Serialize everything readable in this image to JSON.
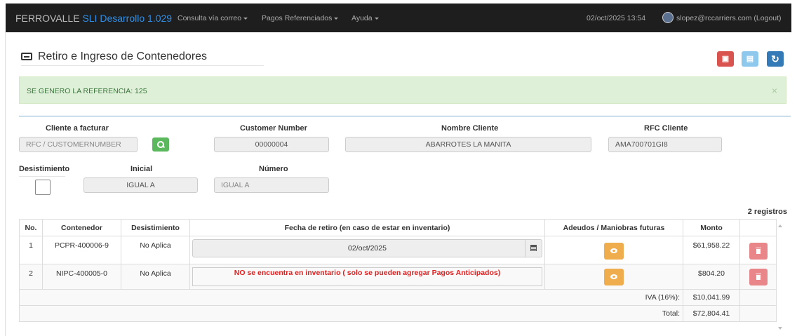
{
  "navbar": {
    "brand_prefix": "FERROVALLE",
    "brand_name": "SLI Desarrollo 1.029",
    "menu": [
      "Consulta vía correo",
      "Pagos Referenciados",
      "Ayuda"
    ],
    "datetime": "02/oct/2025 13:54",
    "user": "slopez@rccarriers.com (Logout)"
  },
  "header": {
    "title": "Retiro e Ingreso de Contenedores"
  },
  "alert": {
    "message": "SE GENERO LA REFERENCIA: 125",
    "close": "×"
  },
  "toolbar": {
    "refresh": "↻"
  },
  "form": {
    "cliente_label": "Cliente a facturar",
    "cliente_placeholder": "RFC / CUSTOMERNUMBER",
    "customer_number_label": "Customer Number",
    "customer_number_value": "00000004",
    "nombre_label": "Nombre Cliente",
    "nombre_value": "ABARROTES LA MANITA",
    "rfc_label": "RFC Cliente",
    "rfc_value": "AMA700701GI8",
    "desistimiento_label": "Desistimiento",
    "inicial_label": "Inicial",
    "inicial_value": "IGUAL A",
    "numero_label": "Número",
    "numero_value": "IGUAL A"
  },
  "table": {
    "count": "2 registros",
    "headers": [
      "No.",
      "Contenedor",
      "Desistimiento",
      "Fecha de retiro (en caso de estar en inventario)",
      "Adeudos / Maniobras futuras",
      "Monto",
      ""
    ],
    "rows": [
      {
        "no": "1",
        "contenedor": "PCPR-400006-9",
        "desistimiento": "No Aplica",
        "fecha": "02/oct/2025",
        "monto": "$61,958.22"
      },
      {
        "no": "2",
        "contenedor": "NIPC-400005-0",
        "desistimiento": "No Aplica",
        "fecha": "NO se encuentra en inventario ( solo se pueden agregar Pagos Anticipados)",
        "monto": "$804.20"
      }
    ],
    "iva_label": "IVA (16%):",
    "iva_value": "$10,041.99",
    "total_label": "Total:",
    "total_value": "$72,804.41"
  }
}
